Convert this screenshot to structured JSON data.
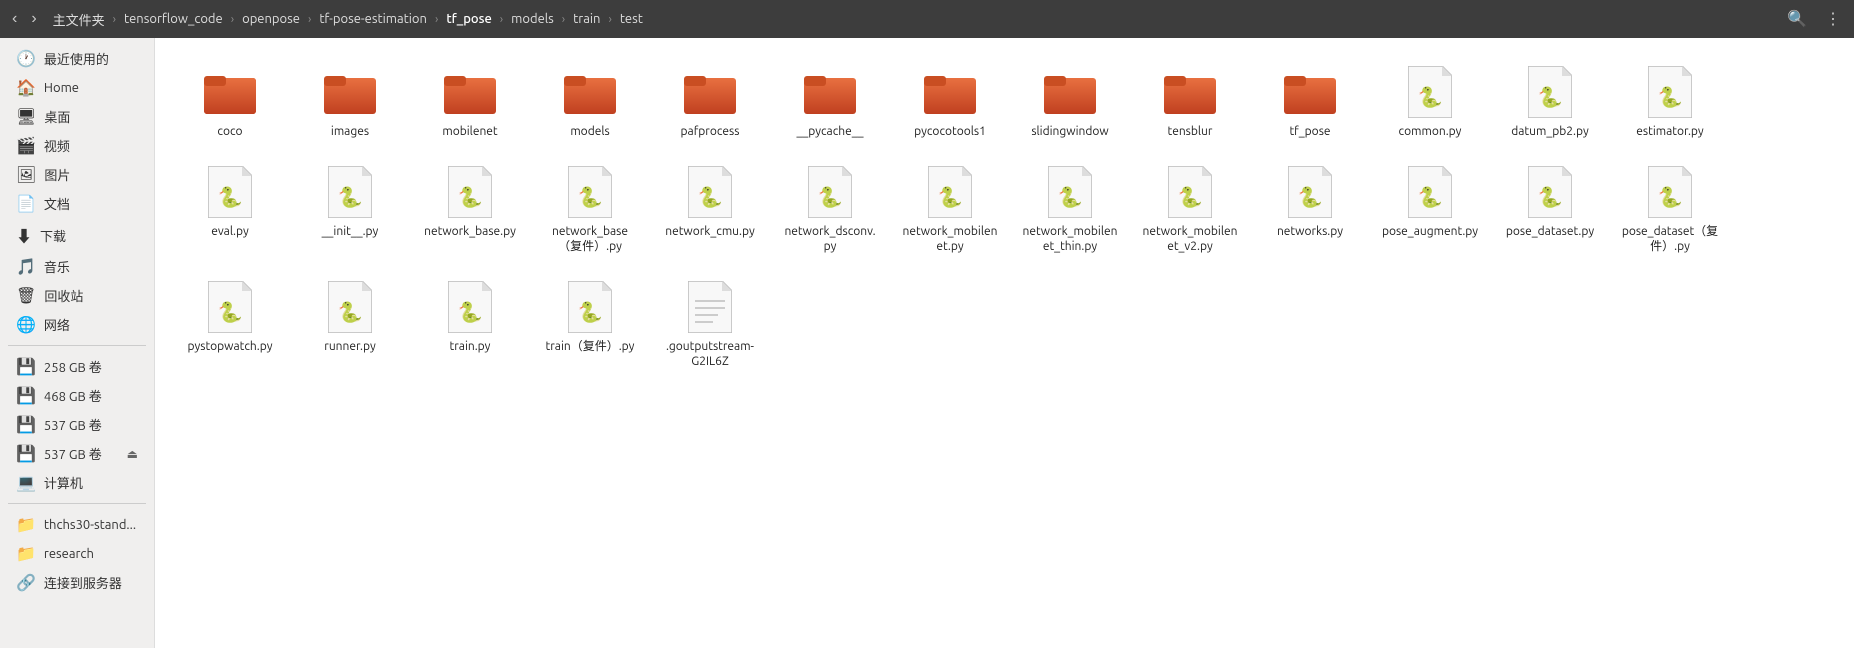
{
  "topbar": {
    "nav": {
      "back_label": "‹",
      "forward_label": "›",
      "back_title": "Back",
      "forward_title": "Forward"
    },
    "breadcrumbs": [
      {
        "label": "主文件夹",
        "active": false
      },
      {
        "label": "tensorflow_code",
        "active": false
      },
      {
        "label": "openpose",
        "active": false
      },
      {
        "label": "tf-pose-estimation",
        "active": false
      },
      {
        "label": "tf_pose",
        "active": true
      },
      {
        "label": "models",
        "active": false
      },
      {
        "label": "train",
        "active": false
      },
      {
        "label": "test",
        "active": false
      }
    ],
    "search_label": "🔍",
    "view_label": "⋮⋮"
  },
  "sidebar": {
    "items": [
      {
        "label": "最近使用的",
        "icon": "🕐",
        "section": "main",
        "active": false
      },
      {
        "label": "Home",
        "icon": "🏠",
        "section": "main",
        "active": false
      },
      {
        "label": "桌面",
        "icon": "🖥",
        "section": "main",
        "active": false
      },
      {
        "label": "视频",
        "icon": "🎬",
        "section": "main",
        "active": false
      },
      {
        "label": "图片",
        "icon": "🖼",
        "section": "main",
        "active": false
      },
      {
        "label": "文档",
        "icon": "📄",
        "section": "main",
        "active": false
      },
      {
        "label": "下载",
        "icon": "⬇",
        "section": "main",
        "active": false
      },
      {
        "label": "音乐",
        "icon": "🎵",
        "section": "main",
        "active": false
      },
      {
        "label": "回收站",
        "icon": "🗑",
        "section": "main",
        "active": false
      },
      {
        "label": "网络",
        "icon": "🌐",
        "section": "main",
        "active": false
      },
      {
        "label": "258 GB 卷",
        "icon": "💾",
        "section": "drives",
        "active": false,
        "eject": false
      },
      {
        "label": "468 GB 卷",
        "icon": "💾",
        "section": "drives",
        "active": false,
        "eject": false
      },
      {
        "label": "537 GB 卷",
        "icon": "💾",
        "section": "drives",
        "active": false,
        "eject": false
      },
      {
        "label": "537 GB 卷",
        "icon": "💾",
        "section": "drives",
        "active": false,
        "eject": true
      },
      {
        "label": "计算机",
        "icon": "💻",
        "section": "drives",
        "active": false
      },
      {
        "label": "thchs30-stand...",
        "icon": "📁",
        "section": "bookmarks",
        "active": false
      },
      {
        "label": "research",
        "icon": "📁",
        "section": "bookmarks",
        "active": false
      },
      {
        "label": "连接到服务器",
        "icon": "🔗",
        "section": "bookmarks",
        "active": false
      }
    ]
  },
  "files": {
    "folders": [
      {
        "name": "coco",
        "type": "folder"
      },
      {
        "name": "images",
        "type": "folder"
      },
      {
        "name": "mobilenet",
        "type": "folder"
      },
      {
        "name": "models",
        "type": "folder"
      },
      {
        "name": "pafprocess",
        "type": "folder"
      },
      {
        "name": "__pycache__",
        "type": "folder"
      },
      {
        "name": "pycocotools1",
        "type": "folder"
      },
      {
        "name": "slidingwindow",
        "type": "folder"
      },
      {
        "name": "tensblur",
        "type": "folder"
      },
      {
        "name": "tf_pose",
        "type": "folder"
      }
    ],
    "python_files": [
      {
        "name": "common.py",
        "type": "python"
      },
      {
        "name": "datum_pb2.py",
        "type": "python"
      },
      {
        "name": "estimator.py",
        "type": "python"
      },
      {
        "name": "eval.py",
        "type": "python"
      },
      {
        "name": "__init__.py",
        "type": "python"
      },
      {
        "name": "network_base.py",
        "type": "python"
      },
      {
        "name": "network_base（复件）.py",
        "type": "python"
      },
      {
        "name": "network_cmu.py",
        "type": "python"
      },
      {
        "name": "network_dsconv.py",
        "type": "python"
      },
      {
        "name": "network_mobilenet.py",
        "type": "python"
      },
      {
        "name": "network_mobilenet_thin.py",
        "type": "python"
      },
      {
        "name": "network_mobilenet_v2.py",
        "type": "python"
      },
      {
        "name": "networks.py",
        "type": "python"
      },
      {
        "name": "pose_augment.py",
        "type": "python"
      },
      {
        "name": "pose_dataset.py",
        "type": "python"
      },
      {
        "name": "pose_dataset（复件）.py",
        "type": "python"
      },
      {
        "name": "pystopwatch.py",
        "type": "python"
      },
      {
        "name": "runner.py",
        "type": "python"
      },
      {
        "name": "train.py",
        "type": "python"
      },
      {
        "name": "train（复件）.py",
        "type": "python"
      }
    ],
    "other_files": [
      {
        "name": ".goutputstream-G2IL6Z",
        "type": "text"
      }
    ]
  }
}
